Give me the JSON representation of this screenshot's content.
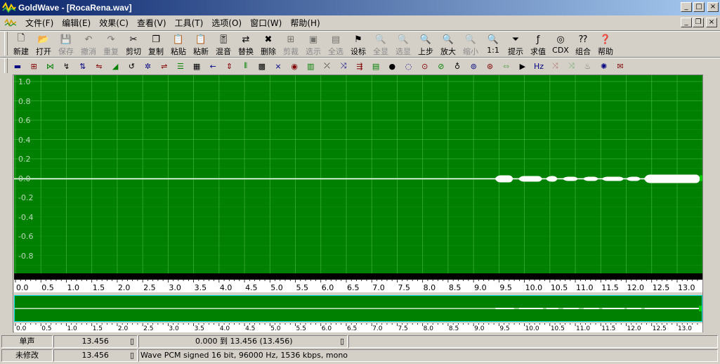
{
  "window": {
    "title": "GoldWave - [RocaRena.wav]"
  },
  "colors": {
    "wave_bg": "#008000",
    "grid": "#4fbf4f",
    "waveform": "#ffffff",
    "title_blue": "#0a246a"
  },
  "menu": [
    "文件(F)",
    "编辑(E)",
    "效果(C)",
    "查看(V)",
    "工具(T)",
    "选项(O)",
    "窗口(W)",
    "帮助(H)"
  ],
  "toolbar": [
    {
      "label": "新建",
      "icon": "new-file-icon",
      "enabled": true
    },
    {
      "label": "打开",
      "icon": "open-folder-icon",
      "enabled": true
    },
    {
      "label": "保存",
      "icon": "save-disk-icon",
      "enabled": false
    },
    {
      "label": "撤消",
      "icon": "undo-icon",
      "enabled": false
    },
    {
      "label": "重复",
      "icon": "redo-icon",
      "enabled": false
    },
    {
      "label": "剪切",
      "icon": "scissors-icon",
      "enabled": true
    },
    {
      "label": "复制",
      "icon": "copy-icon",
      "enabled": true
    },
    {
      "label": "粘贴",
      "icon": "paste-icon",
      "enabled": true
    },
    {
      "label": "粘新",
      "icon": "paste-new-icon",
      "enabled": true
    },
    {
      "label": "混音",
      "icon": "mix-icon",
      "enabled": true
    },
    {
      "label": "替换",
      "icon": "replace-icon",
      "enabled": true
    },
    {
      "label": "删除",
      "icon": "delete-icon",
      "enabled": true
    },
    {
      "label": "剪裁",
      "icon": "trim-icon",
      "enabled": false
    },
    {
      "label": "选示",
      "icon": "select-view-icon",
      "enabled": false
    },
    {
      "label": "全选",
      "icon": "select-all-icon",
      "enabled": false
    },
    {
      "label": "设标",
      "icon": "set-marker-icon",
      "enabled": true
    },
    {
      "label": "全显",
      "icon": "show-all-icon",
      "enabled": false
    },
    {
      "label": "选显",
      "icon": "zoom-selection-icon",
      "enabled": false
    },
    {
      "label": "上步",
      "icon": "zoom-previous-icon",
      "enabled": true
    },
    {
      "label": "放大",
      "icon": "zoom-in-icon",
      "enabled": true
    },
    {
      "label": "缩小",
      "icon": "zoom-out-icon",
      "enabled": false
    },
    {
      "label": "1:1",
      "icon": "zoom-1to1-icon",
      "enabled": true
    },
    {
      "label": "提示",
      "icon": "cue-points-icon",
      "enabled": true
    },
    {
      "label": "求值",
      "icon": "expression-icon",
      "enabled": true
    },
    {
      "label": "CDX",
      "icon": "cd-extract-icon",
      "enabled": true
    },
    {
      "label": "组合",
      "icon": "batch-icon",
      "enabled": true
    },
    {
      "label": "帮助",
      "icon": "help-icon",
      "enabled": true
    }
  ],
  "effects_toolbar_count": 38,
  "y_axis": {
    "labels": [
      "1.0",
      "0.8",
      "0.6",
      "0.4",
      "0.2",
      "0.0",
      "-0.2",
      "-0.4",
      "-0.6",
      "-0.8"
    ]
  },
  "time_axis": {
    "start": 0.0,
    "end": 13.456,
    "step": 0.5,
    "labels": [
      "0.0",
      "0.5",
      "1.0",
      "1.5",
      "2.0",
      "2.5",
      "3.0",
      "3.5",
      "4.0",
      "4.5",
      "5.0",
      "5.5",
      "6.0",
      "6.5",
      "7.0",
      "7.5",
      "8.0",
      "8.5",
      "9.0",
      "9.5",
      "10.0",
      "10.5",
      "11.0",
      "11.5",
      "12.0",
      "12.5",
      "13.0"
    ]
  },
  "status": {
    "channel": "单声",
    "length": "13.456",
    "selection": "0.000 到 13.456 (13.456)",
    "modified": "未修改",
    "length2": "13.456",
    "format": "Wave PCM signed 16 bit, 96000 Hz, 1536 kbps, mono"
  }
}
